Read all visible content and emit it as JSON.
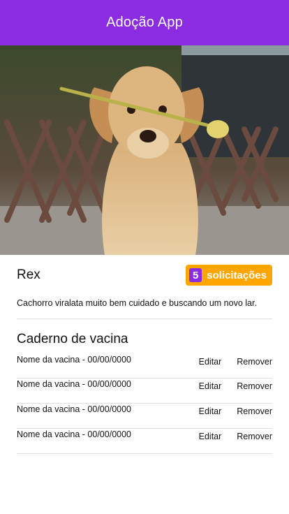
{
  "appbar": {
    "title": "Adoção App"
  },
  "pet": {
    "photo_alt": "",
    "name": "Rex",
    "requests": {
      "count": "5",
      "label": "solicitações"
    },
    "description": "Cachorro viralata muito bem cuidado e buscando um novo lar."
  },
  "vaccines": {
    "title": "Caderno de vacina",
    "edit_label": "Editar",
    "remove_label": "Remover",
    "items": [
      {
        "name": "Nome da vacina - 00/00/0000"
      },
      {
        "name": "Nome da vacina - 00/00/0000"
      },
      {
        "name": "Nome da vacina - 00/00/0000"
      },
      {
        "name": "Nome da vacina - 00/00/0000"
      }
    ]
  },
  "colors": {
    "primary": "#8b2be2",
    "badge": "#ffa500",
    "divider": "#e0e0e0"
  }
}
